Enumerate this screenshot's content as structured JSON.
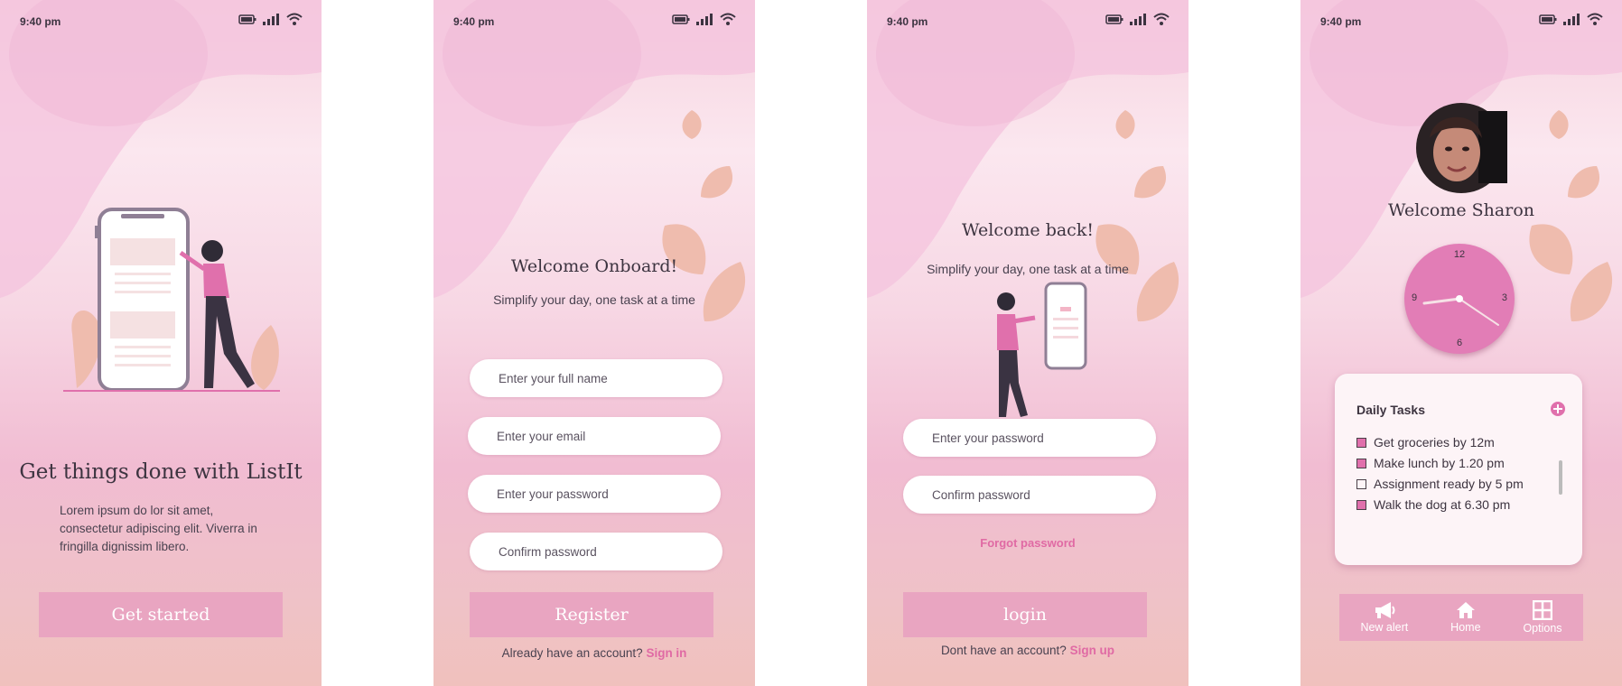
{
  "status": {
    "time": "9:40 pm"
  },
  "screen1": {
    "title": "Get things done with ListIt",
    "paragraph": "Lorem ipsum do  lor sit amet, consectetur adipiscing elit. Viverra in fringilla dignissim libero.",
    "button": "Get started"
  },
  "screen2": {
    "title": "Welcome Onboard!",
    "subtitle": "Simplify your day, one task at a  time",
    "fields": {
      "full_name": "Enter your full name",
      "email": "Enter your email",
      "password": "Enter your password",
      "confirm": "Confirm password"
    },
    "button": "Register",
    "footer_text": "Already have an account?",
    "footer_link": "Sign in"
  },
  "screen3": {
    "title": "Welcome back!",
    "subtitle": "Simplify your day, one task at a  time",
    "fields": {
      "password": "Enter your password",
      "confirm": "Confirm password"
    },
    "forgot": "Forgot password",
    "button": "login",
    "footer_text": "Dont have an account?",
    "footer_link": "Sign up"
  },
  "screen4": {
    "welcome": "Welcome Sharon",
    "clock": {
      "n12": "12",
      "n3": "3",
      "n6": "6",
      "n9": "9"
    },
    "card_title": "Daily Tasks",
    "tasks": [
      {
        "label": "Get groceries by 12m",
        "done": true
      },
      {
        "label": "Make lunch by 1.20 pm",
        "done": true
      },
      {
        "label": "Assignment ready by 5 pm",
        "done": false
      },
      {
        "label": "Walk the dog at 6.30 pm",
        "done": true
      }
    ],
    "nav": [
      {
        "label": "New alert",
        "icon": "megaphone-icon"
      },
      {
        "label": "Home",
        "icon": "home-icon"
      },
      {
        "label": "Options",
        "icon": "grid-icon"
      }
    ]
  },
  "colors": {
    "accent": "#e9a5c1",
    "link": "#e06aa4",
    "leaf": "#efbcae"
  }
}
